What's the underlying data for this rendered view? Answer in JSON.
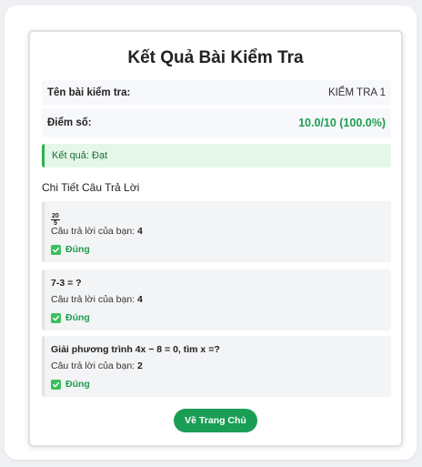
{
  "title": "Kết Quả Bài Kiểm Tra",
  "info": {
    "test_name_label": "Tên bài kiểm tra:",
    "test_name_value": "KIỂM TRA 1",
    "score_label": "Điểm số:",
    "score_value": "10.0/10 (100.0%)"
  },
  "result": {
    "text": "Kết quả: Đạt"
  },
  "details": {
    "section_title": "Chi Tiết Câu Trả Lời",
    "answer_prefix": "Câu trả lời của bạn: ",
    "questions": [
      {
        "numerator": "20",
        "denominator": "5",
        "text": "",
        "answer": "4",
        "status": "Đúng"
      },
      {
        "text": "7-3 = ?",
        "answer": "4",
        "status": "Đúng"
      },
      {
        "text": "Giải phương trình 4x − 8 = 0, tìm x =?",
        "answer": "2",
        "status": "Đúng"
      }
    ]
  },
  "home_button_label": "Về Trang Chủ",
  "colors": {
    "accent_green": "#1a9e55",
    "success_text": "#1f9d4f",
    "result_bg": "#e4f7e8"
  }
}
